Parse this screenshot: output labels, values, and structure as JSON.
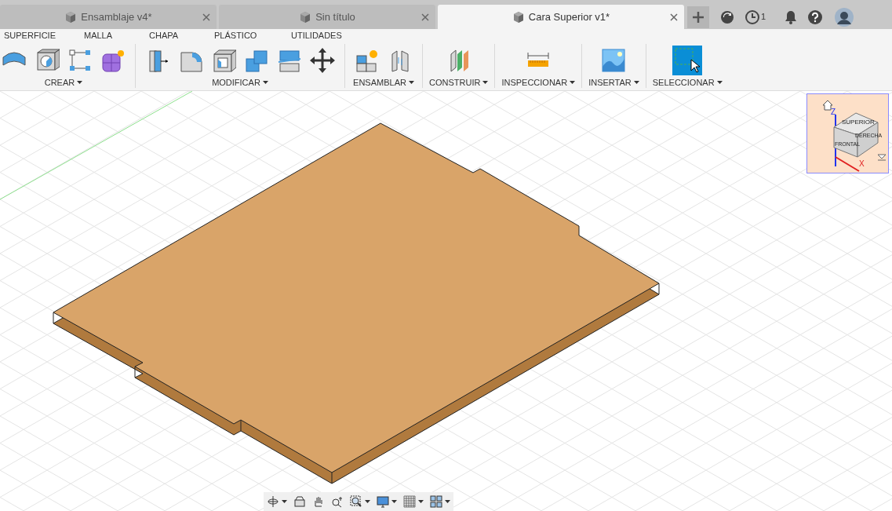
{
  "tabs": [
    {
      "label": "Ensamblaje v4*",
      "selected": false
    },
    {
      "label": "Sin título",
      "selected": false
    },
    {
      "label": "Cara Superior v1*",
      "selected": true
    }
  ],
  "job_count": "1",
  "ribbon_tabs": [
    "SUPERFICIE",
    "MALLA",
    "CHAPA",
    "PLÁSTICO",
    "UTILIDADES"
  ],
  "groups": [
    {
      "label": "CREAR",
      "tools": [
        {
          "kind": "surface"
        },
        {
          "kind": "box-hole"
        },
        {
          "kind": "sketch-points"
        },
        {
          "kind": "form"
        }
      ]
    },
    {
      "label": "MODIFICAR",
      "tools": [
        {
          "kind": "press-pull"
        },
        {
          "kind": "fillet"
        },
        {
          "kind": "shell"
        },
        {
          "kind": "combine"
        },
        {
          "kind": "split"
        },
        {
          "kind": "move"
        }
      ]
    },
    {
      "label": "ENSAMBLAR",
      "tools": [
        {
          "kind": "new-component"
        },
        {
          "kind": "joint"
        }
      ]
    },
    {
      "label": "CONSTRUIR",
      "tools": [
        {
          "kind": "plane"
        }
      ]
    },
    {
      "label": "INSPECCIONAR",
      "tools": [
        {
          "kind": "measure"
        }
      ]
    },
    {
      "label": "INSERTAR",
      "tools": [
        {
          "kind": "image"
        }
      ]
    },
    {
      "label": "SELECCIONAR",
      "tools": [
        {
          "kind": "select"
        }
      ]
    }
  ],
  "viewcube": {
    "top": "SUPERIOR",
    "front": "FRONTAL",
    "right": "DERECHA",
    "axis_z": "Z",
    "axis_x": "X"
  },
  "nav_tools": [
    {
      "kind": "orbit",
      "dropdown": true
    },
    {
      "kind": "look",
      "dropdown": false
    },
    {
      "kind": "pan",
      "dropdown": false
    },
    {
      "kind": "zoom",
      "dropdown": false
    },
    {
      "kind": "fit",
      "dropdown": true
    },
    {
      "kind": "display",
      "dropdown": true
    },
    {
      "kind": "grid",
      "dropdown": true
    },
    {
      "kind": "viewports",
      "dropdown": true
    }
  ]
}
